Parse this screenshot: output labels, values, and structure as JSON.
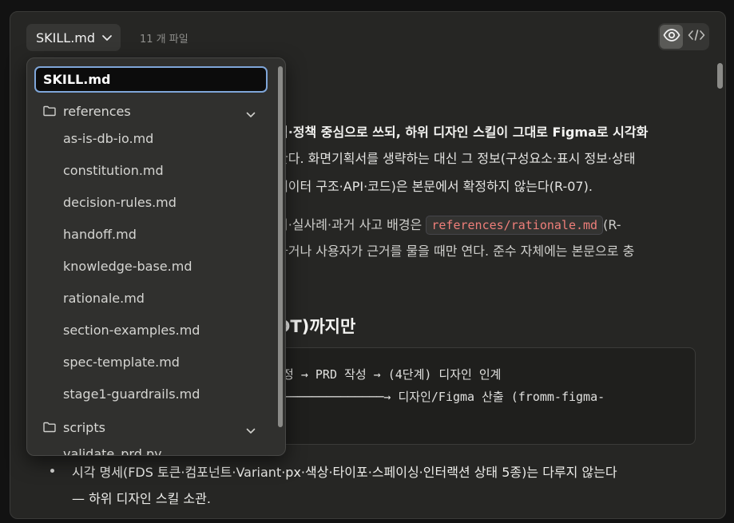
{
  "header": {
    "file_button_label": "SKILL.md",
    "file_count": "11 개 파일"
  },
  "view_toggle": {
    "preview_icon": "eye-icon",
    "code_icon": "code-icon"
  },
  "document": {
    "p1": [
      "적·정책 중심으로 쓰되, 하위 디자인 스킬이 그대로 Figma로 시각화",
      "한다. 화면기획서를 생략하는 대신 그 정보(구성요소·표시 정보·상태",
      "데이터 구조·API·코드)은 본문에서 확정하지 않는다(R-07)."
    ],
    "p2_line1_before": "지·실사례·과거 사고 배경은 ",
    "p2_code": "references/rationale.md",
    "p2_line1_after": "(R-",
    "p2_line2": "하거나 사용자가 근거를 물을 때만 연다. 준수 자체에는 본문으로 충",
    "heading": "DT)까지만",
    "code_lines": [
      "정 → PRD 작성 → (4단계) 디자인 인계",
      "──────────────→ 디자인/Figma 산출 (fromm-figma-"
    ],
    "bullet_lines": [
      "시각 명세(FDS 토큰·컴포넌트·Variant·px·색상·타이포·스페이싱·인터랙션 상태 5종)는 다루지 않는다",
      "— 하위 디자인 스킬 소관."
    ]
  },
  "dropdown": {
    "search_value": "SKILL.md",
    "folders": [
      {
        "name": "references",
        "files": [
          "as-is-db-io.md",
          "constitution.md",
          "decision-rules.md",
          "handoff.md",
          "knowledge-base.md",
          "rationale.md",
          "section-examples.md",
          "spec-template.md",
          "stage1-guardrails.md"
        ]
      },
      {
        "name": "scripts",
        "files": [
          "validate_prd.py"
        ]
      }
    ]
  },
  "colors": {
    "panel_bg": "#262624",
    "dropdown_bg": "#30302e",
    "focus_border": "#7fa6d9",
    "inline_code": "#ef7f7a"
  }
}
